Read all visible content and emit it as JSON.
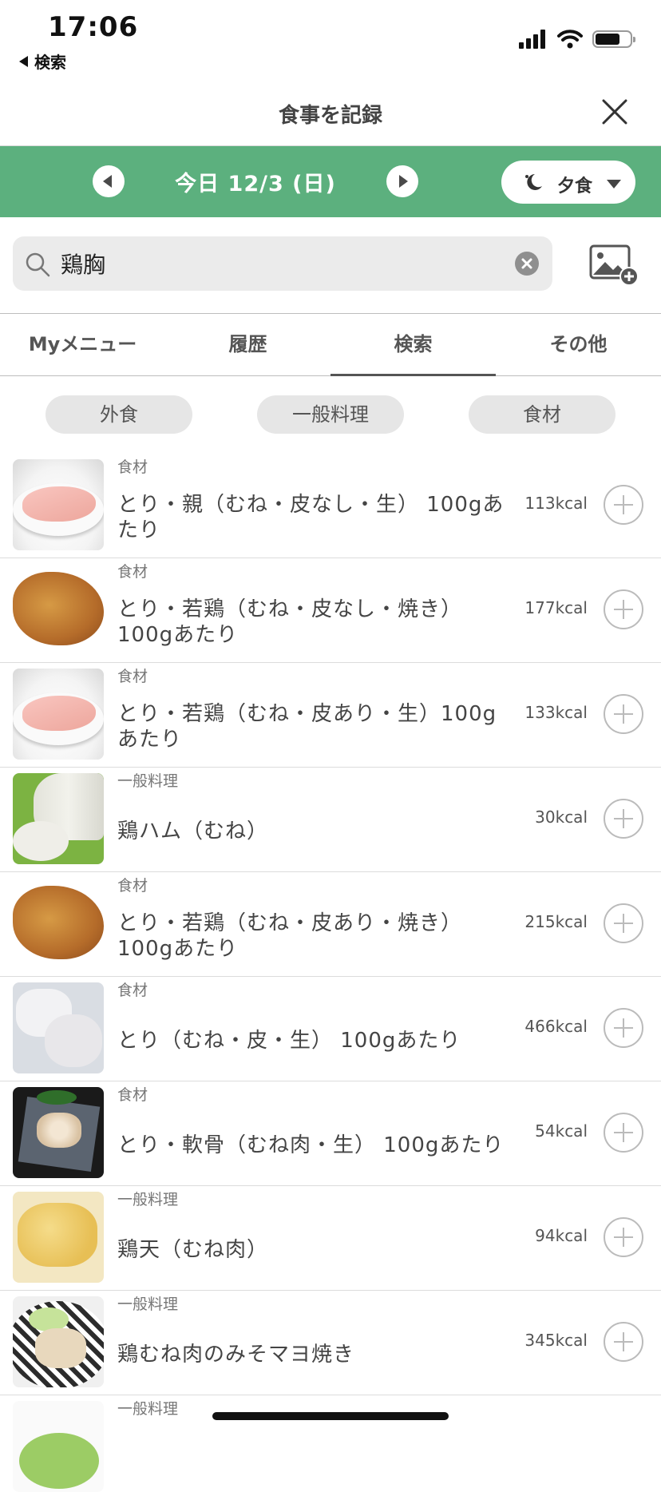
{
  "status_bar": {
    "time": "17:06",
    "back_label": "検索"
  },
  "header": {
    "title": "食事を記録"
  },
  "date_bar": {
    "date_label": "今日 12/3 (日)",
    "meal_label": "夕食"
  },
  "search": {
    "query": "鶏胸"
  },
  "tabs": [
    {
      "label": "Myメニュー",
      "active": false
    },
    {
      "label": "履歴",
      "active": false
    },
    {
      "label": "検索",
      "active": true
    },
    {
      "label": "その他",
      "active": false
    }
  ],
  "filters": [
    "外食",
    "一般料理",
    "食材"
  ],
  "results": [
    {
      "category": "食材",
      "name": "とり・親（むね・皮なし・生） 100gあたり",
      "kcal": "113kcal",
      "thumb": "raw-breast"
    },
    {
      "category": "食材",
      "name": "とり・若鶏（むね・皮なし・焼き）100gあたり",
      "kcal": "177kcal",
      "thumb": "roast-chicken"
    },
    {
      "category": "食材",
      "name": "とり・若鶏（むね・皮あり・生）100gあたり",
      "kcal": "133kcal",
      "thumb": "raw-breast"
    },
    {
      "category": "一般料理",
      "name": "鶏ハム（むね）",
      "kcal": "30kcal",
      "thumb": "chicken-ham"
    },
    {
      "category": "食材",
      "name": "とり・若鶏（むね・皮あり・焼き）100gあたり",
      "kcal": "215kcal",
      "thumb": "roast-chicken"
    },
    {
      "category": "食材",
      "name": "とり（むね・皮・生） 100gあたり",
      "kcal": "466kcal",
      "thumb": "chicken-skin"
    },
    {
      "category": "食材",
      "name": "とり・軟骨（むね肉・生） 100gあたり",
      "kcal": "54kcal",
      "thumb": "cartilage"
    },
    {
      "category": "一般料理",
      "name": "鶏天（むね肉）",
      "kcal": "94kcal",
      "thumb": "tempura"
    },
    {
      "category": "一般料理",
      "name": "鶏むね肉のみそマヨ焼き",
      "kcal": "345kcal",
      "thumb": "miso-mayo"
    },
    {
      "category": "一般料理",
      "name": "",
      "kcal": "",
      "thumb": "salad"
    }
  ],
  "colors": {
    "accent_green": "#5cb07e",
    "chip_bg": "#e6e6e6",
    "search_bg": "#ebebeb"
  }
}
